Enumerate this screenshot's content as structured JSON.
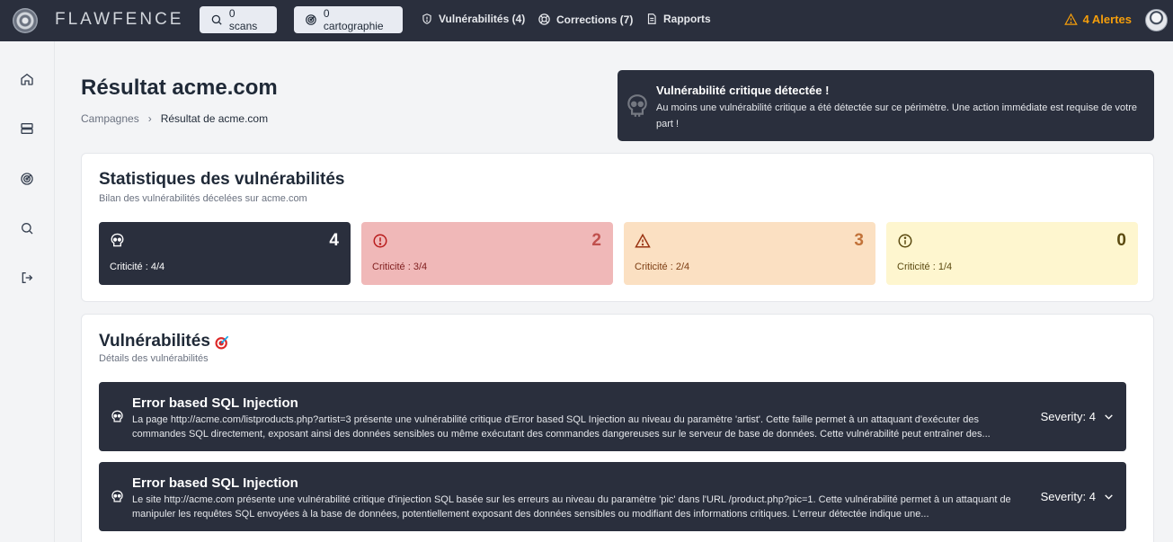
{
  "header": {
    "brand": "FLAWFENCE",
    "scans_label": "0 scans",
    "carto_label": "0 cartographie",
    "vulns_label": "Vulnérabilités (4)",
    "corrections_label": "Corrections (7)",
    "reports_label": "Rapports",
    "alerts_label": "4 Alertes"
  },
  "page": {
    "title": "Résultat acme.com",
    "breadcrumb": [
      "Campagnes",
      "Résultat de acme.com"
    ]
  },
  "alert": {
    "title": "Vulnérabilité critique détectée !",
    "text": "Au moins une vulnérabilité critique a été détectée sur ce périmètre. Une action immédiate est requise de votre part !"
  },
  "stats": {
    "title": "Statistiques des vulnérabilités",
    "subtitle": "Bilan des vulnérabilités décelées sur acme.com",
    "cards": [
      {
        "count": "4",
        "criticity": "Criticité : 4/4",
        "bg": "#2a2f3d",
        "fg": "#ffffff",
        "icon": "skull-icon"
      },
      {
        "count": "2",
        "criticity": "Criticité : 3/4",
        "bg": "#f0b8b8",
        "fg": "#7f1d1d",
        "icon": "alert-circle-icon"
      },
      {
        "count": "3",
        "criticity": "Criticité : 2/4",
        "bg": "#fbe0c2",
        "fg": "#7c3d12",
        "icon": "warning-triangle-icon"
      },
      {
        "count": "0",
        "criticity": "Criticité : 1/4",
        "bg": "#fef6cf",
        "fg": "#5b4a10",
        "icon": "info-circle-icon"
      }
    ]
  },
  "vulns": {
    "title": "Vulnérabilités",
    "subtitle": "Détails des vulnérabilités",
    "items": [
      {
        "title": "Error based SQL Injection",
        "desc": "La page http://acme.com/listproducts.php?artist=3 présente une vulnérabilité critique d'Error based SQL Injection au niveau du paramètre 'artist'. Cette faille permet à un attaquant d'exécuter des commandes SQL directement, exposant ainsi des données sensibles ou même exécutant des commandes dangereuses sur le serveur de base de données. Cette vulnérabilité peut entraîner des...",
        "severity": "Severity: 4"
      },
      {
        "title": "Error based SQL Injection",
        "desc": "Le site http://acme.com présente une vulnérabilité critique d'injection SQL basée sur les erreurs au niveau du paramètre 'pic' dans l'URL /product.php?pic=1. Cette vulnérabilité permet à un attaquant de manipuler les requêtes SQL envoyées à la base de données, potentiellement exposant des données sensibles ou modifiant des informations critiques. L'erreur détectée indique une...",
        "severity": "Severity: 4"
      }
    ]
  }
}
